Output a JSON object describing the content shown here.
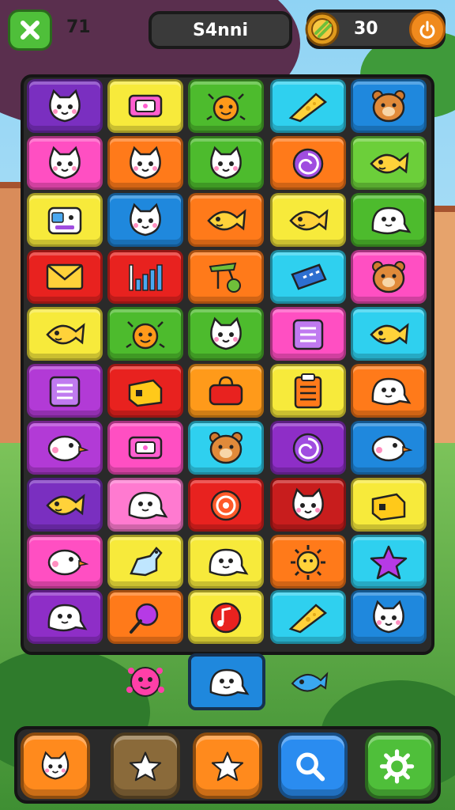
{
  "header": {
    "moves_label": "71",
    "title_label": "S4nni",
    "coins_label": "30"
  },
  "icons": {
    "close": "close-icon",
    "coin": "coin-medal-icon",
    "coin_button": "power-icon"
  },
  "board": {
    "rows": [
      [
        {
          "color": "#7a2fc0",
          "icon": "cat-face"
        },
        {
          "color": "#f7ea3b",
          "icon": "tag"
        },
        {
          "color": "#4dbb2d",
          "icon": "critter"
        },
        {
          "color": "#2fd0ef",
          "icon": "cheese"
        },
        {
          "color": "#1f88dd",
          "icon": "bear-face"
        }
      ],
      [
        {
          "color": "#ff4fc2",
          "icon": "cat-face"
        },
        {
          "color": "#ff7a1a",
          "icon": "cat-face"
        },
        {
          "color": "#4dbb2d",
          "icon": "cat-face"
        },
        {
          "color": "#ff7a1a",
          "icon": "swirl"
        },
        {
          "color": "#6ccf3a",
          "icon": "fish"
        }
      ],
      [
        {
          "color": "#f7ea3b",
          "icon": "robot-face"
        },
        {
          "color": "#1f88dd",
          "icon": "cat-face"
        },
        {
          "color": "#ff7a1a",
          "icon": "fish"
        },
        {
          "color": "#f7ea3b",
          "icon": "fish"
        },
        {
          "color": "#4dbb2d",
          "icon": "ghost"
        }
      ],
      [
        {
          "color": "#e8221f",
          "icon": "envelope"
        },
        {
          "color": "#e8221f",
          "icon": "bar-chart"
        },
        {
          "color": "#ff7a1a",
          "icon": "cherry"
        },
        {
          "color": "#2fd0ef",
          "icon": "ticket"
        },
        {
          "color": "#ff4fc2",
          "icon": "bear-face"
        }
      ],
      [
        {
          "color": "#f7ea3b",
          "icon": "fish"
        },
        {
          "color": "#4dbb2d",
          "icon": "critter"
        },
        {
          "color": "#4dbb2d",
          "icon": "cat-face"
        },
        {
          "color": "#ff4fc2",
          "icon": "list"
        },
        {
          "color": "#2fd0ef",
          "icon": "fish"
        }
      ],
      [
        {
          "color": "#b23ad6",
          "icon": "list"
        },
        {
          "color": "#e8221f",
          "icon": "box"
        },
        {
          "color": "#ff9a1a",
          "icon": "bag"
        },
        {
          "color": "#f7ea3b",
          "icon": "clipboard"
        },
        {
          "color": "#ff7a1a",
          "icon": "ghost"
        }
      ],
      [
        {
          "color": "#b23ad6",
          "icon": "bird"
        },
        {
          "color": "#ff4fc2",
          "icon": "tag"
        },
        {
          "color": "#2fd0ef",
          "icon": "bear-face"
        },
        {
          "color": "#8e2ec7",
          "icon": "swirl"
        },
        {
          "color": "#1f88dd",
          "icon": "bird"
        }
      ],
      [
        {
          "color": "#7a2fc0",
          "icon": "fish"
        },
        {
          "color": "#ff7ad0",
          "icon": "ghost"
        },
        {
          "color": "#e8221f",
          "icon": "spiral"
        },
        {
          "color": "#c81d1d",
          "icon": "cat-face"
        },
        {
          "color": "#f7ea3b",
          "icon": "box"
        }
      ],
      [
        {
          "color": "#ff4fc2",
          "icon": "bird"
        },
        {
          "color": "#f7ea3b",
          "icon": "dino"
        },
        {
          "color": "#f7ea3b",
          "icon": "ghost"
        },
        {
          "color": "#ff7a1a",
          "icon": "sun"
        },
        {
          "color": "#2fd0ef",
          "icon": "star"
        }
      ],
      [
        {
          "color": "#8e2ec7",
          "icon": "ghost"
        },
        {
          "color": "#ff7a1a",
          "icon": "spoon"
        },
        {
          "color": "#f7ea3b",
          "icon": "note"
        },
        {
          "color": "#2fd0ef",
          "icon": "cheese"
        },
        {
          "color": "#1f88dd",
          "icon": "cat-face"
        }
      ]
    ],
    "extra_tile": {
      "color": "#1f88dd",
      "icon": "ghost"
    },
    "floating": [
      "pink-critter-icon",
      "blue-fish-icon"
    ]
  },
  "bottom_bar": {
    "buttons": [
      {
        "name": "cat-button",
        "icon": "cat-face",
        "color": "#ff8a1d"
      },
      {
        "name": "star-ghost-button",
        "icon": "star",
        "color": "#8a6a3a"
      },
      {
        "name": "star-button",
        "icon": "star",
        "color": "#ff8a1d"
      },
      {
        "name": "search-button",
        "icon": "search",
        "color": "#2a8cf0"
      },
      {
        "name": "settings-button",
        "icon": "gear",
        "color": "#4fbf3a"
      }
    ]
  }
}
